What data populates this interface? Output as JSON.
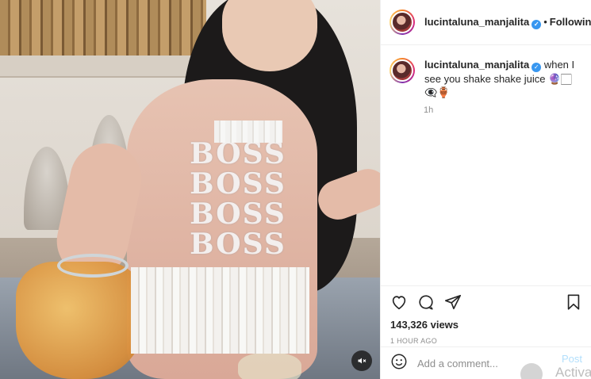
{
  "post": {
    "username": "lucintaluna_manjalita",
    "follow_status": "Following",
    "more_label": "•••",
    "caption_text": "when I see you shake shake juice 🔮🏻👁️‍🗨️🏺",
    "caption_time": "1h",
    "likes": "143,326 views",
    "timestamp": "1 HOUR AGO",
    "media_text": [
      "BOSS",
      "BOSS",
      "BOSS",
      "BOSS"
    ]
  },
  "comment": {
    "placeholder": "Add a comment...",
    "post_label": "Post"
  },
  "overlay": {
    "activate_text": "Activa"
  },
  "icons": {
    "emoji": "emoji-icon",
    "like": "heart-icon",
    "comment": "comment-icon",
    "share": "share-icon",
    "save": "bookmark-icon",
    "mute": "volume-muted-icon",
    "verified": "verified-badge-icon"
  },
  "colors": {
    "verified": "#3897f0",
    "muted_text": "#8e8e8e",
    "post_disabled": "#b2dffc"
  }
}
